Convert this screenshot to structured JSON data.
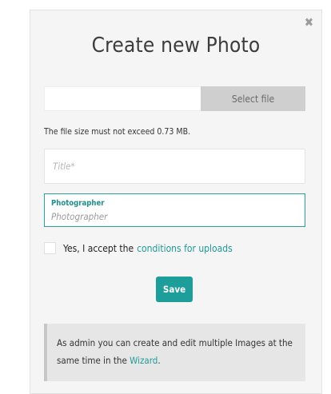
{
  "modal": {
    "close_glyph": "✖",
    "title": "Create new Photo",
    "file": {
      "select_label": "Select file",
      "size_hint": "The file size must not exceed 0.73 MB."
    },
    "title_input": {
      "placeholder": "Title*",
      "value": ""
    },
    "photographer": {
      "label": "Photographer",
      "placeholder": "Photographer",
      "value": ""
    },
    "accept": {
      "text": "Yes, I accept the",
      "link": "conditions for uploads",
      "checked": false
    },
    "save_label": "Save",
    "info": {
      "text": "As admin you can create and edit multiple Images at the same time in the",
      "link": "Wizard",
      "suffix": "."
    }
  },
  "colors": {
    "accent": "#1e9e9a",
    "modal_bg": "#f5f5f5",
    "button_gray": "#cfcfcf",
    "info_bg": "#e6e6e6"
  }
}
